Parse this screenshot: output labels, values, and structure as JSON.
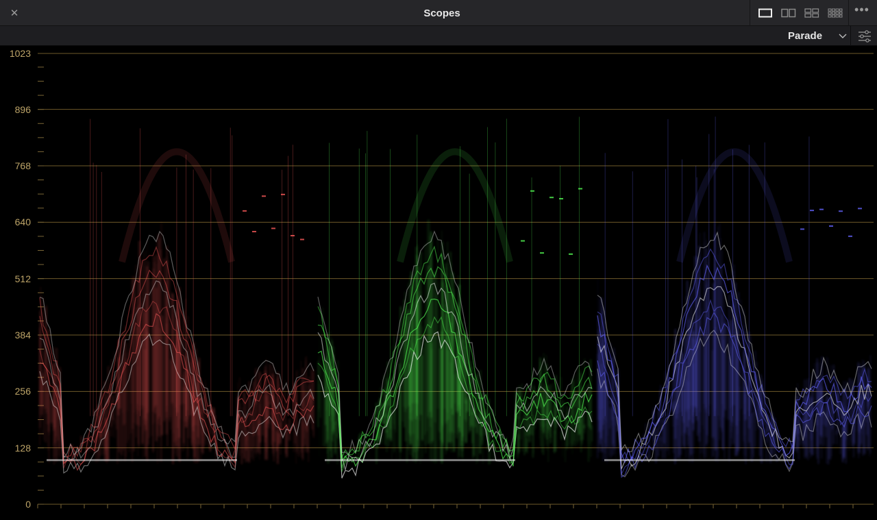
{
  "window": {
    "title": "Scopes",
    "close_glyph": "✕",
    "more_glyph": "•••"
  },
  "layout_buttons": [
    {
      "name": "single-view",
      "icon": "single-layout-icon",
      "active": true
    },
    {
      "name": "dual-view",
      "icon": "dual-layout-icon",
      "active": false
    },
    {
      "name": "quad-view",
      "icon": "quad-layout-icon",
      "active": false
    },
    {
      "name": "grid-view",
      "icon": "grid-layout-icon",
      "active": false
    }
  ],
  "toolbar": {
    "mode": "Parade",
    "settings_icon": "sliders-icon"
  },
  "scope": {
    "type": "waveform-parade",
    "y_range": [
      0,
      1023
    ],
    "y_ticks": [
      "1023",
      "896",
      "768",
      "640",
      "512",
      "384",
      "256",
      "128",
      "0"
    ],
    "channels": [
      {
        "channel": "red",
        "color": "#ff5c5c"
      },
      {
        "channel": "green",
        "color": "#56ff56"
      },
      {
        "channel": "blue",
        "color": "#6464ff"
      }
    ],
    "gridline_color": "#6e5a2a",
    "label_color": "#bda468"
  }
}
